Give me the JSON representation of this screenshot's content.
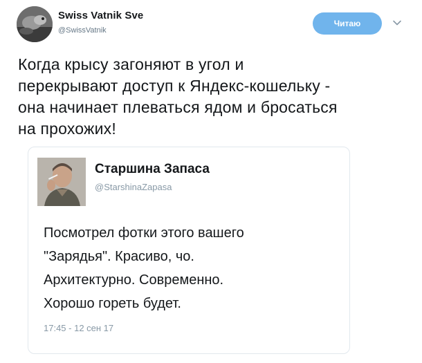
{
  "author": {
    "name": "Swiss Vatnik Sve",
    "handle": "@SwissVatnik",
    "follow_label": "Читаю"
  },
  "icons": {
    "avatar": "avatar-image",
    "menu": "chevron-down-icon"
  },
  "tweet": {
    "text": "Когда крысу загоняют в угол и\nперекрывают доступ к Яндекс-кошельку -\nона начинает плеваться ядом и бросаться\nна прохожих!"
  },
  "quoted": {
    "name": "Старшина Запаса",
    "handle": "@StarshinaZapasa",
    "text": "Посмотрел фотки этого вашего\n\"Зарядья\". Красиво, чо.\nАрхитектурно. Современно.\nХорошо гореть будет.",
    "timestamp": "17:45 - 12 сен 17"
  },
  "colors": {
    "follow_button": "#70b4ec",
    "secondary_text": "#657786",
    "border": "#e1e8ed"
  }
}
